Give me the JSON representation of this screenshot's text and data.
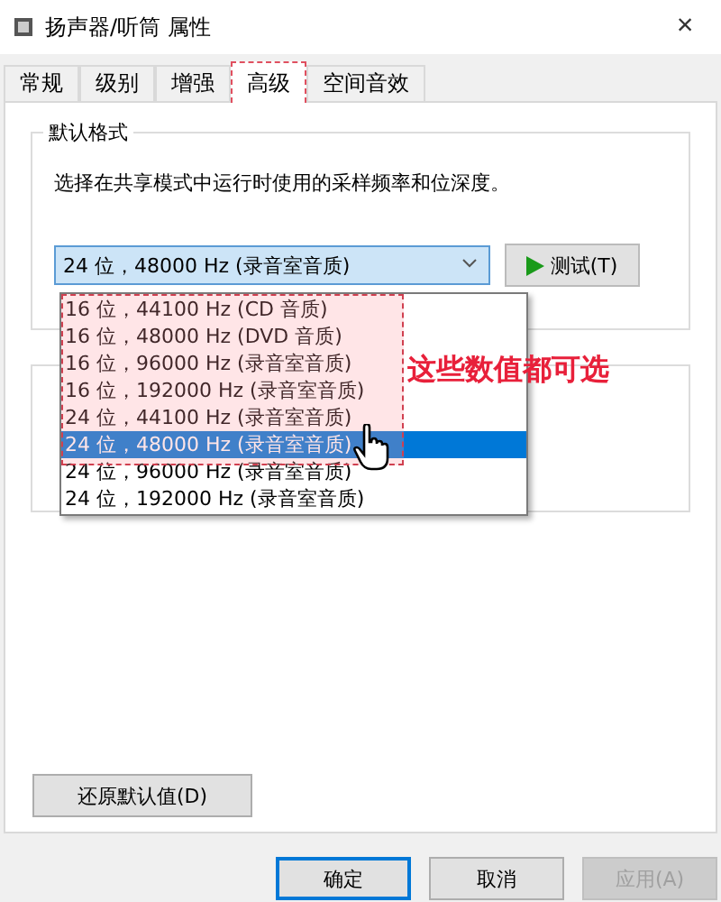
{
  "window": {
    "title": "扬声器/听筒 属性",
    "close": "×"
  },
  "tabs": [
    {
      "label": "常规",
      "selected": false
    },
    {
      "label": "级别",
      "selected": false
    },
    {
      "label": "增强",
      "selected": false
    },
    {
      "label": "高级",
      "selected": true
    },
    {
      "label": "空间音效",
      "selected": false
    }
  ],
  "default_format": {
    "title": "默认格式",
    "description": "选择在共享模式中运行时使用的采样频率和位深度。",
    "value": "24 位，48000 Hz (录音室音质)",
    "test_button": "测试(T)",
    "options": [
      {
        "label": "16 位，44100 Hz (CD 音质)",
        "selected": false
      },
      {
        "label": "16 位，48000 Hz (DVD 音质)",
        "selected": false
      },
      {
        "label": "16 位，96000 Hz (录音室音质)",
        "selected": false
      },
      {
        "label": "16 位，192000 Hz (录音室音质)",
        "selected": false
      },
      {
        "label": "24 位，44100 Hz (录音室音质)",
        "selected": false
      },
      {
        "label": "24 位，48000 Hz (录音室音质)",
        "selected": true
      },
      {
        "label": "24 位，96000 Hz (录音室音质)",
        "selected": false
      },
      {
        "label": "24 位，192000 Hz (录音室音质)",
        "selected": false
      }
    ]
  },
  "annotation": "这些数值都可选",
  "restore_button": "还原默认值(D)",
  "buttons": [
    {
      "label": "确定",
      "disabled": false
    },
    {
      "label": "取消",
      "disabled": false
    },
    {
      "label": "应用(A)",
      "disabled": true
    }
  ]
}
